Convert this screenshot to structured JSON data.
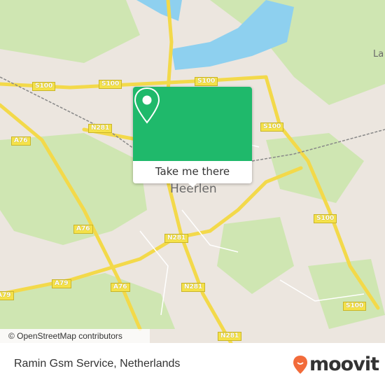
{
  "map": {
    "place_label": "Heerlen",
    "partial_label": "La",
    "attribution": "© OpenStreetMap contributors",
    "road_shields": [
      {
        "label": "S100"
      },
      {
        "label": "S100"
      },
      {
        "label": "S100"
      },
      {
        "label": "S100"
      },
      {
        "label": "S100"
      },
      {
        "label": "S100"
      },
      {
        "label": "A76"
      },
      {
        "label": "A76"
      },
      {
        "label": "A76"
      },
      {
        "label": "N281"
      },
      {
        "label": "N281"
      },
      {
        "label": "N281"
      },
      {
        "label": "N281"
      },
      {
        "label": "A79"
      },
      {
        "label": "A79"
      }
    ],
    "colors": {
      "land": "#ece6df",
      "park": "#c9e3a8",
      "water": "#8ed0ef",
      "road": "#f3d94a",
      "accent": "#1fb96b"
    }
  },
  "popup": {
    "icon": "map-pin-icon",
    "button_label": "Take me there"
  },
  "footer": {
    "title": "Ramin Gsm Service, Netherlands",
    "brand": "moovit",
    "brand_color": "#f26b3a"
  }
}
